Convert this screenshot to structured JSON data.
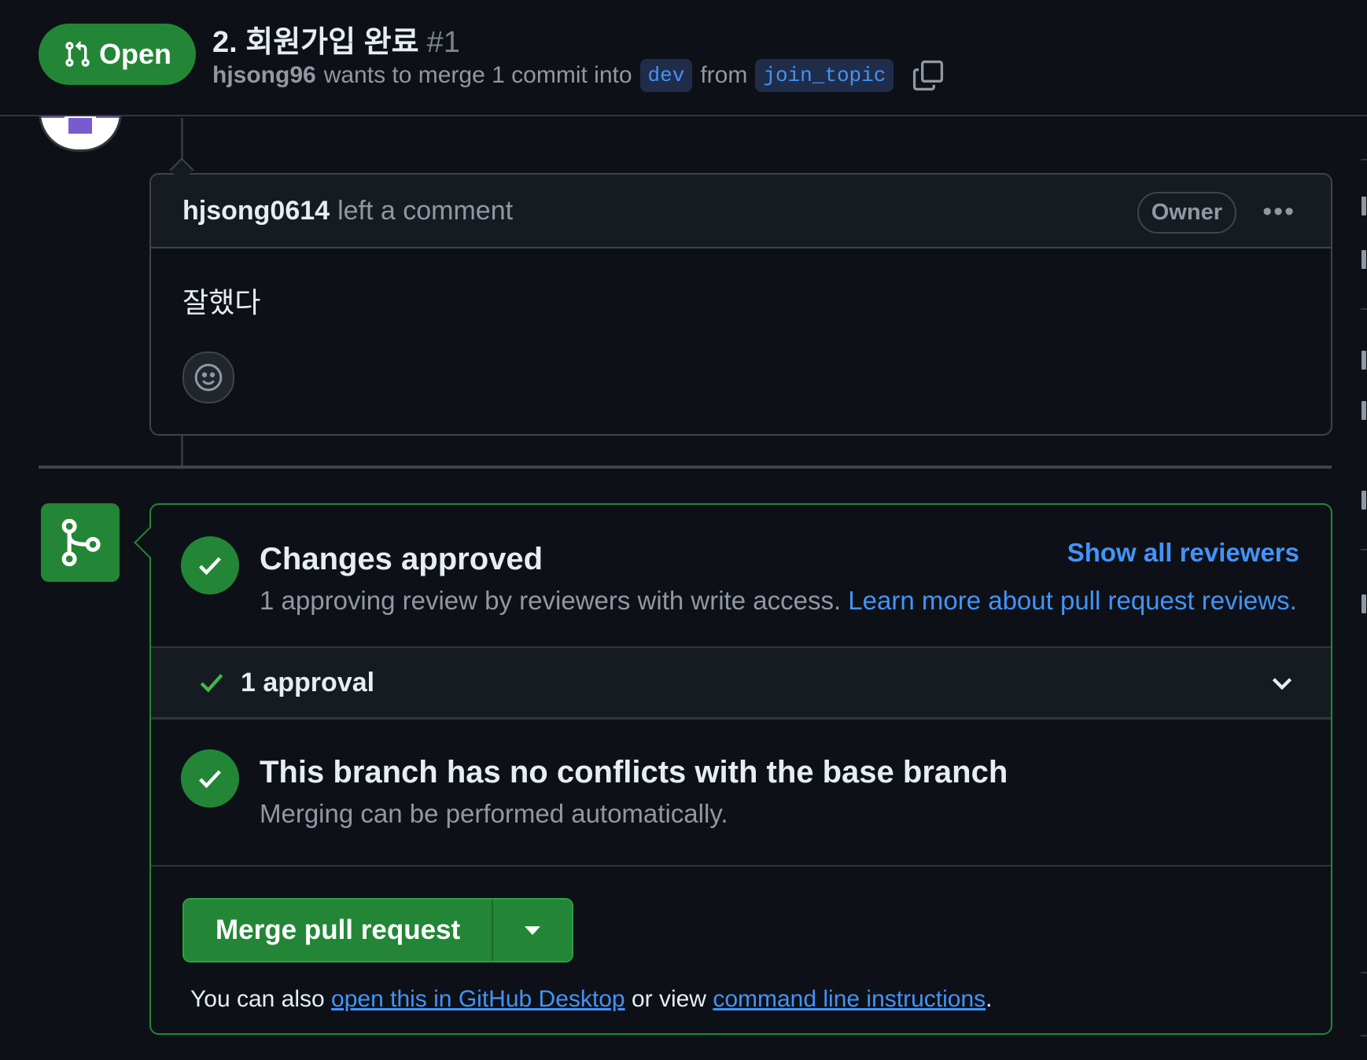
{
  "header": {
    "state_label": "Open",
    "title": "2. 회원가입 완료",
    "number": "#1",
    "author": "hjsong96",
    "merge_text_1": "wants to merge 1 commit into",
    "base_branch": "dev",
    "merge_text_2": "from",
    "head_branch": "join_topic"
  },
  "comment": {
    "author": "hjsong0614",
    "action": "left a comment",
    "role_badge": "Owner",
    "body": "잘했다"
  },
  "merge_box": {
    "approved": {
      "title": "Changes approved",
      "description": "1 approving review by reviewers with write access.",
      "link": "Learn more about pull request reviews.",
      "show_reviewers": "Show all reviewers"
    },
    "approval_row": {
      "label": "1 approval"
    },
    "conflicts": {
      "title": "This branch has no conflicts with the base branch",
      "description": "Merging can be performed automatically."
    },
    "merge": {
      "button_label": "Merge pull request",
      "hint_prefix": "You can also",
      "hint_link_1": "open this in GitHub Desktop",
      "hint_middle": "or view",
      "hint_link_2": "command line instructions",
      "hint_suffix": "."
    }
  },
  "colors": {
    "background": "#0d1117",
    "success": "#238636",
    "link": "#4493f8",
    "border": "#30363d",
    "muted_text": "#9198a1"
  },
  "icons": [
    "git-pull-request-icon",
    "copy-icon",
    "kebab-icon",
    "smiley-icon",
    "git-merge-icon",
    "check-circle-icon",
    "check-icon",
    "chevron-down-icon",
    "triangle-down-icon"
  ]
}
